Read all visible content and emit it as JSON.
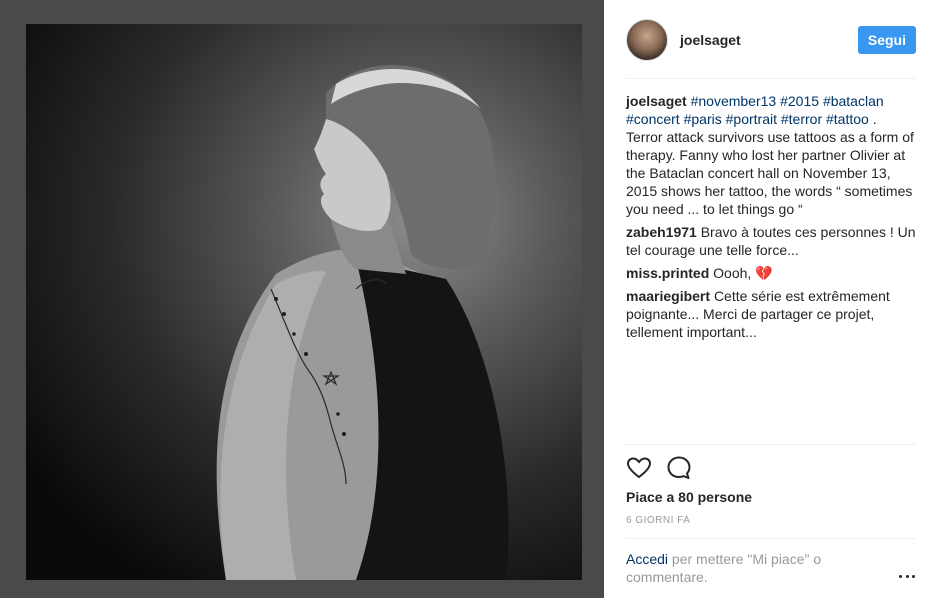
{
  "post": {
    "username": "joelsaget",
    "follow_label": "Segui",
    "image_alt": "Portrait photo of a woman showing a star tattoo on her shoulder"
  },
  "caption": {
    "user": "joelsaget",
    "tags": [
      "#november13",
      "#2015",
      "#bataclan",
      "#concert",
      "#paris",
      "#portrait",
      "#terror",
      "#tattoo"
    ],
    "text": ". Terror attack survivors use tattoos as a form of therapy. Fanny who lost her partner Olivier at the Bataclan concert hall on November 13, 2015 shows her tattoo, the words “ sometimes you need ... to let things go “"
  },
  "comments": [
    {
      "user": "zabeh1971",
      "text": "Bravo à toutes ces personnes ! Un tel courage une telle force..."
    },
    {
      "user": "miss.printed",
      "text": "Oooh, 💔"
    },
    {
      "user": "maariegibert",
      "text": "Cette série est extrêmement poignante... Merci de partager ce projet, tellement important..."
    }
  ],
  "actions": {
    "like_icon": "heart-icon",
    "comment_icon": "comment-icon",
    "likes_text": "Piace a 80 persone",
    "date_text": "6 GIORNI FA"
  },
  "login": {
    "link_text": "Accedi",
    "rest_text": "per mettere \"Mi piace\" o commentare."
  },
  "colors": {
    "accent": "#3897f0",
    "link": "#003569",
    "muted": "#999999"
  }
}
